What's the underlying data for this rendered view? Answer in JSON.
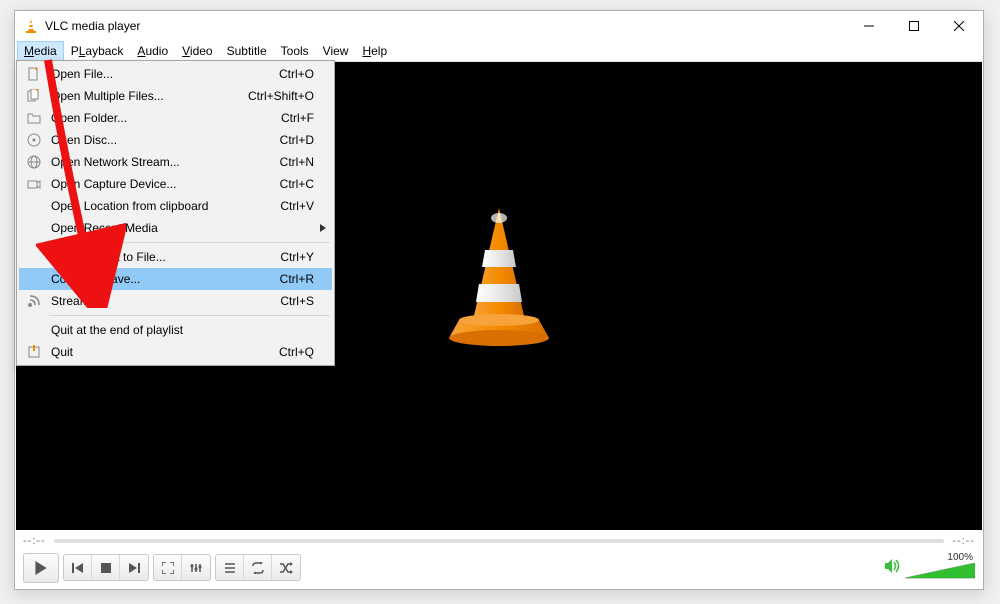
{
  "titlebar": {
    "title": "VLC media player"
  },
  "menubar": {
    "items": [
      {
        "label": "Media",
        "underline": "M",
        "active": true
      },
      {
        "label": "Playback",
        "underline": "L"
      },
      {
        "label": "Audio",
        "underline": "A"
      },
      {
        "label": "Video",
        "underline": "V"
      },
      {
        "label": "Subtitle",
        "underline": ""
      },
      {
        "label": "Tools",
        "underline": ""
      },
      {
        "label": "View",
        "underline": ""
      },
      {
        "label": "Help",
        "underline": "H"
      }
    ]
  },
  "media_menu": {
    "items": [
      {
        "icon": "file-icon",
        "label": "Open File...",
        "shortcut": "Ctrl+O",
        "underline": "F"
      },
      {
        "icon": "files-icon",
        "label": "Open Multiple Files...",
        "shortcut": "Ctrl+Shift+O",
        "underline": "O"
      },
      {
        "icon": "folder-icon",
        "label": "Open Folder...",
        "shortcut": "Ctrl+F",
        "underline": "F"
      },
      {
        "icon": "disc-icon",
        "label": "Open Disc...",
        "shortcut": "Ctrl+D",
        "underline": "D"
      },
      {
        "icon": "network-icon",
        "label": "Open Network Stream...",
        "shortcut": "Ctrl+N",
        "underline": "N"
      },
      {
        "icon": "capture-icon",
        "label": "Open Capture Device...",
        "shortcut": "Ctrl+C",
        "underline": "C"
      },
      {
        "icon": "",
        "label": "Open Location from clipboard",
        "shortcut": "Ctrl+V",
        "underline": ""
      },
      {
        "icon": "",
        "label": "Open Recent Media",
        "shortcut": "",
        "underline": "R",
        "submenu": true
      },
      {
        "sep": true
      },
      {
        "icon": "",
        "label": "Save Playlist to File...",
        "shortcut": "Ctrl+Y",
        "underline": ""
      },
      {
        "icon": "",
        "label": "Convert / Save...",
        "shortcut": "Ctrl+R",
        "underline": "",
        "highlight": true
      },
      {
        "icon": "stream-icon",
        "label": "Stream...",
        "shortcut": "Ctrl+S",
        "underline": "S"
      },
      {
        "sep": true
      },
      {
        "icon": "",
        "label": "Quit at the end of playlist",
        "shortcut": "",
        "underline": ""
      },
      {
        "icon": "quit-icon",
        "label": "Quit",
        "shortcut": "Ctrl+Q",
        "underline": ""
      }
    ]
  },
  "seek": {
    "left": "--:--",
    "right": "--:--"
  },
  "volume": {
    "label": "100%"
  },
  "icons": {
    "play": "play",
    "prev": "prev",
    "stop": "stop",
    "next": "next",
    "fullscreen": "fullscreen",
    "extended": "extended",
    "playlist": "playlist",
    "loop": "loop",
    "shuffle": "shuffle",
    "speaker": "speaker"
  }
}
